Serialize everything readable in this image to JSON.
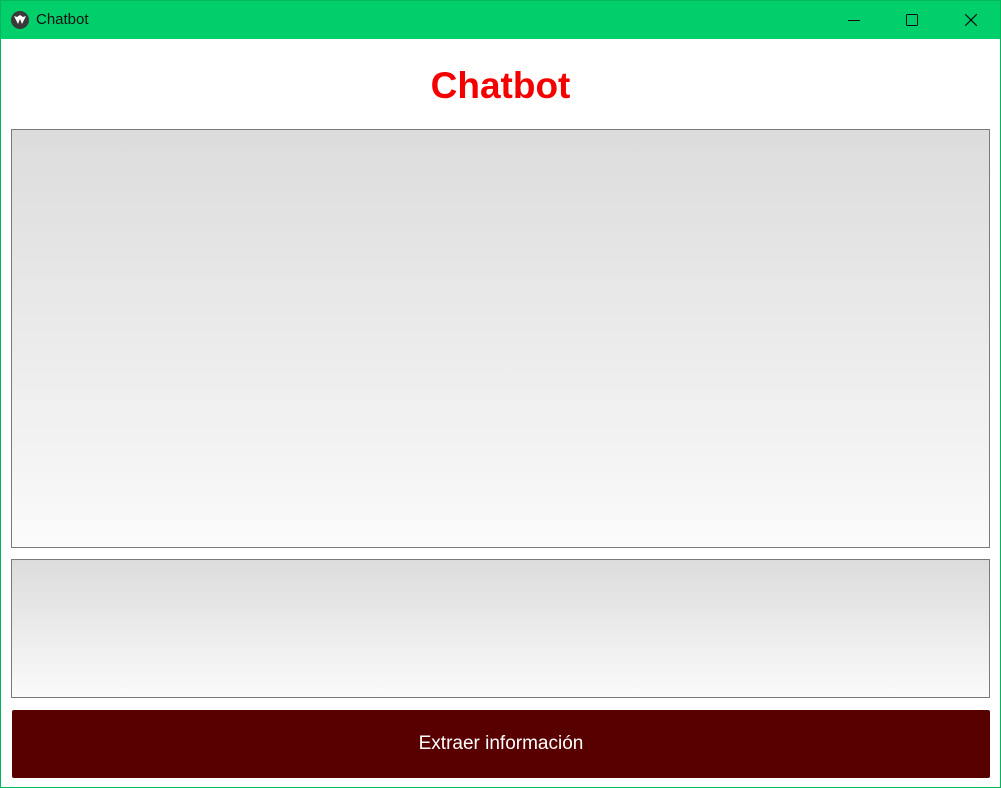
{
  "window": {
    "title": "Chatbot",
    "titlebar_color": "#00cf6b",
    "icon": "kivy-app-icon",
    "controls": [
      "minimize-icon",
      "maximize-icon",
      "close-icon"
    ]
  },
  "main": {
    "heading": "Chatbot",
    "heading_color": "#f40000",
    "chat_output": {
      "value": ""
    },
    "message_input": {
      "value": ""
    },
    "extract_button": {
      "label": "Extraer información",
      "color": "#580000"
    }
  }
}
